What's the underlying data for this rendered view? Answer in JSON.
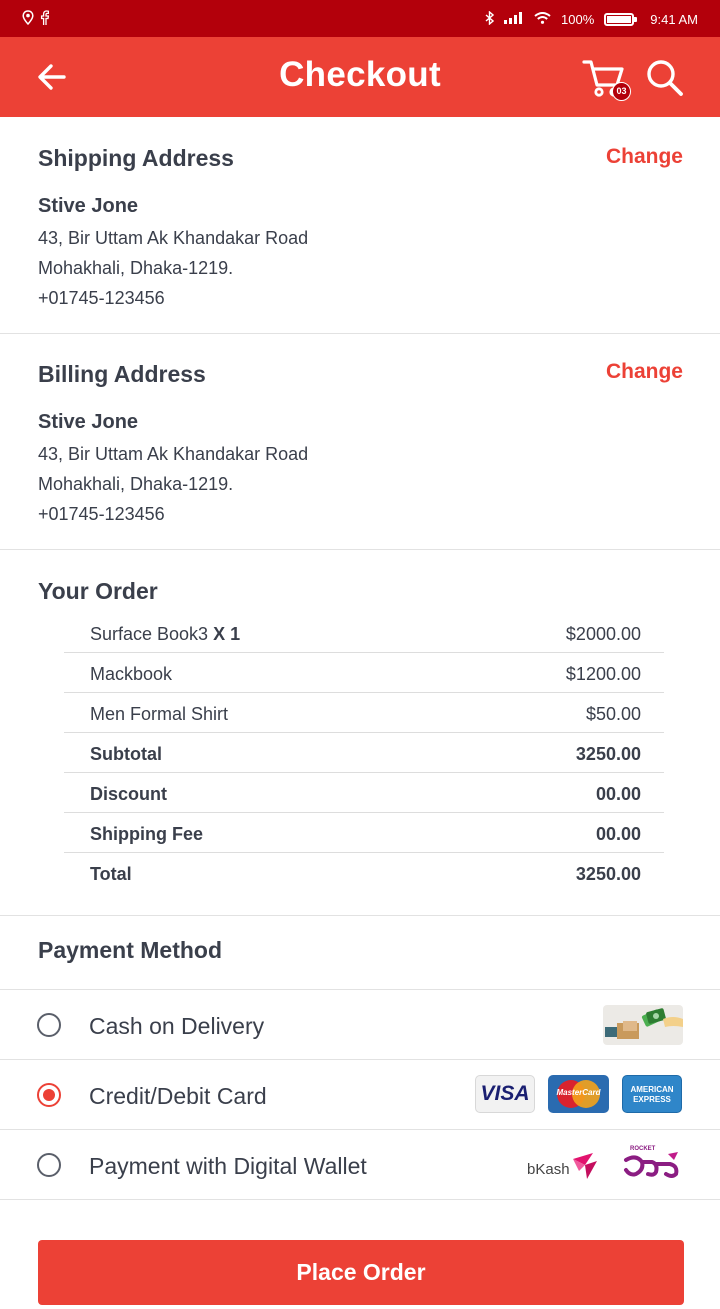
{
  "status_bar": {
    "battery": "100%",
    "time": "9:41 AM",
    "icons": [
      "location-icon",
      "facebook-icon",
      "bluetooth-icon",
      "signal-icon",
      "wifi-icon",
      "battery-icon"
    ]
  },
  "app_bar": {
    "title": "Checkout",
    "cart_badge": "03",
    "icons": [
      "back-arrow-icon",
      "cart-icon",
      "search-icon"
    ]
  },
  "shipping": {
    "title": "Shipping Address",
    "change_label": "Change",
    "name": "Stive Jone",
    "line1": "43, Bir Uttam Ak Khandakar Road",
    "line2": "Mohakhali, Dhaka-1219.",
    "phone": "+01745-123456"
  },
  "billing": {
    "title": "Billing Address",
    "change_label": "Change",
    "name": "Stive Jone",
    "line1": "43, Bir Uttam Ak Khandakar Road",
    "line2": "Mohakhali, Dhaka-1219.",
    "phone": "+01745-123456"
  },
  "order": {
    "title": "Your Order",
    "items": [
      {
        "name": "Surface Book3",
        "qty": "X 1",
        "price": "$2000.00"
      },
      {
        "name": "Mackbook",
        "price": "$1200.00"
      },
      {
        "name": "Men Formal Shirt",
        "price": "$50.00"
      }
    ],
    "subtotal_label": "Subtotal",
    "subtotal": "3250.00",
    "discount_label": "Discount",
    "discount": "00.00",
    "shipping_label": "Shipping Fee",
    "shipping": "00.00",
    "total_label": "Total",
    "total": "3250.00"
  },
  "payment": {
    "title": "Payment Method",
    "options": [
      {
        "label": "Cash on Delivery",
        "selected": false
      },
      {
        "label": "Credit/Debit Card",
        "selected": true
      },
      {
        "label": "Payment with Digital Wallet",
        "selected": false
      }
    ],
    "card_logos": [
      "VISA",
      "MasterCard",
      "AMERICAN EXPRESS"
    ],
    "wallet_logos": [
      "bKash",
      "ROCKET"
    ]
  },
  "place_order_label": "Place Order",
  "colors": {
    "status_bar": "#b3000b",
    "app_bar": "#ec4136",
    "accent": "#ec4136",
    "text": "#3a3f4b"
  }
}
